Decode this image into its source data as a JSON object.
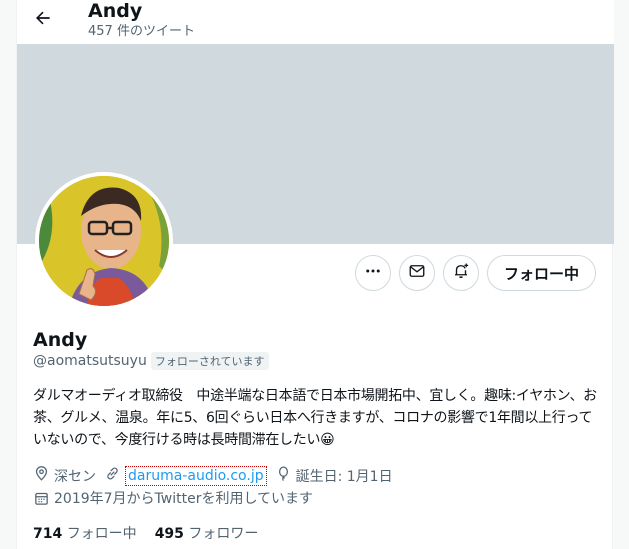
{
  "header": {
    "name": "Andy",
    "tweet_count": "457 件のツイート"
  },
  "profile": {
    "name": "Andy",
    "handle": "@aomatsutsuyu",
    "follows_you": "フォローされています",
    "bio": "ダルマオーディオ取締役　中途半端な日本語で日本市場開拓中、宜しく。趣味:イヤホン、お茶、グルメ、温泉。年に5、6回ぐらい日本へ行きますが、コロナの影響で1年間以上行っていないので、今度行ける時は長時間滞在したい😀",
    "location": "深セン",
    "website": "daruma-audio.co.jp",
    "birthday": "誕生日: 1月1日",
    "joined": "2019年7月からTwitterを利用しています"
  },
  "actions": {
    "follow_label": "フォロー中"
  },
  "stats": {
    "following_count": "714",
    "following_label": "フォロー中",
    "followers_count": "495",
    "followers_label": "フォロワー"
  },
  "colors": {
    "accent": "#1d9bf0",
    "banner": "#cfd9de",
    "secondary_text": "#536471"
  }
}
